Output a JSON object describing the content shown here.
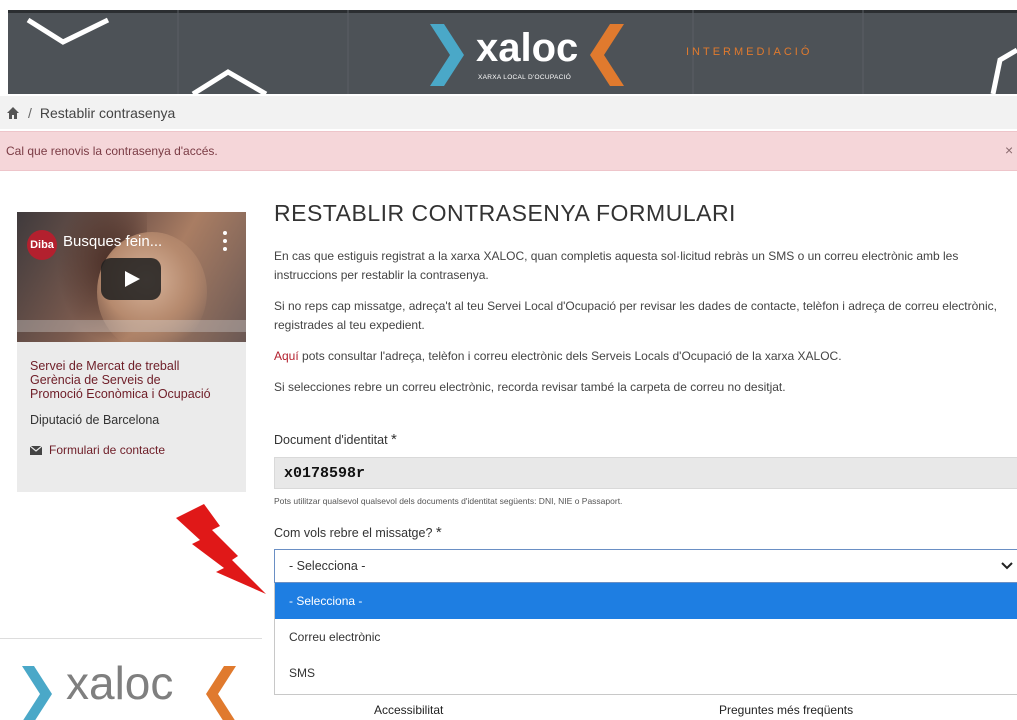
{
  "banner": {
    "brand": "xaloc",
    "brand_sub": "XARXA LOCAL D'OCUPACIÓ",
    "tag": "INTERMEDIACIÓ"
  },
  "breadcrumb": {
    "home_icon": "home-icon",
    "separator": "/",
    "current": "Restablir contrasenya"
  },
  "alert": {
    "message": "Cal que renovis la contrasenya d'accés.",
    "close": "×"
  },
  "sidebar": {
    "video": {
      "channel_badge": "Diba",
      "title": "Busques fein...",
      "play_icon": "play-icon",
      "menu_icon": "more-vertical-icon"
    },
    "org_lines": [
      "Servei de Mercat de treball",
      "Gerència de Serveis de",
      "Promoció Econòmica i Ocupació"
    ],
    "diputacio": "Diputació de Barcelona",
    "contact_link": "Formulari de contacte",
    "contact_icon": "envelope-icon"
  },
  "main": {
    "title": "RESTABLIR CONTRASENYA FORMULARI",
    "paragraphs": {
      "p1": "En cas que estiguis registrat a la xarxa XALOC, quan completis aquesta sol·licitud rebràs un SMS o un correu electrònic amb les instruccions per restablir la contrasenya.",
      "p2": "Si no reps cap missatge, adreça't al teu Servei Local d'Ocupació per revisar les dades de contacte, telèfon i adreça de correu electrònic, registrades al teu expedient.",
      "p3_link": "Aquí",
      "p3_rest": " pots consultar l'adreça, telèfon i correu electrònic dels Serveis Locals d'Ocupació de la xarxa XALOC.",
      "p4": "Si selecciones rebre un correu electrònic, recorda revisar també la carpeta de correu no desitjat."
    },
    "document_field": {
      "label": "Document d'identitat",
      "required_mark": "*",
      "value": "x0178598r",
      "help": "Pots utilitzar qualsevol qualsevol dels documents d'identitat següents: DNI, NIE o Passaport."
    },
    "message_field": {
      "label": "Com vols rebre el missatge?",
      "required_mark": "*",
      "selected": "- Selecciona -",
      "options": [
        "- Selecciona -",
        "Correu electrònic",
        "SMS"
      ]
    }
  },
  "footer": {
    "logo": "xaloc",
    "links": [
      "Accessibilitat",
      "Preguntes més freqüents"
    ]
  },
  "colors": {
    "banner_bg": "#4d5257",
    "brand_blue": "#4aa8c8",
    "brand_orange": "#e07a2e",
    "alert_bg": "#f5d6d9",
    "link_red": "#6e1d27",
    "selected_option": "#1e7ee2",
    "annotation_arrow": "#e01818"
  }
}
